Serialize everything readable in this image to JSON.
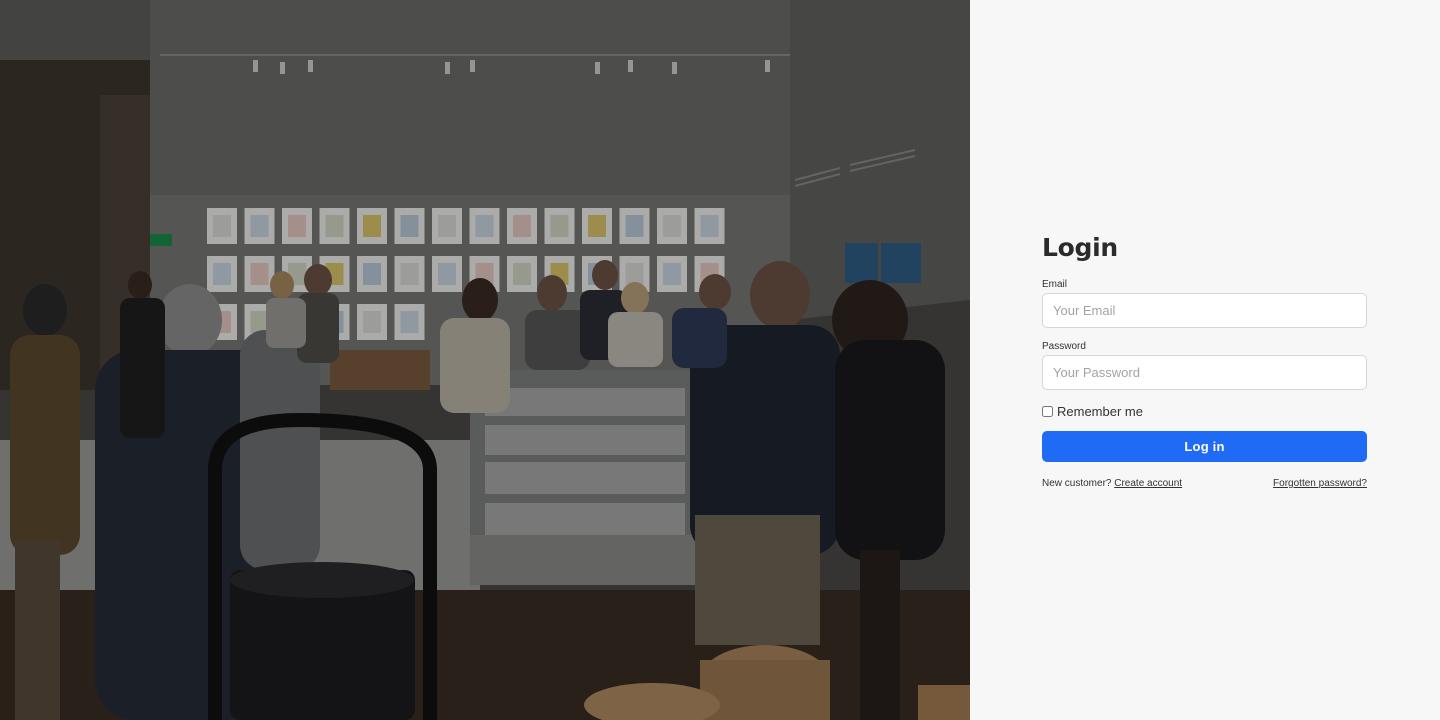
{
  "hero": {
    "image_alt": "Gallery exhibition with visitors"
  },
  "login": {
    "title": "Login",
    "email_label": "Email",
    "email_placeholder": "Your Email",
    "email_value": "",
    "password_label": "Password",
    "password_placeholder": "Your Password",
    "password_value": "",
    "remember_label": "Remember me",
    "remember_checked": false,
    "submit_label": "Log in",
    "new_customer_text": "New customer?",
    "create_account_link": "Create account",
    "forgot_password_link": "Forgotten password?"
  },
  "colors": {
    "primary": "#1f6bf6",
    "panel_background": "#f7f7f7",
    "text": "#2b2b2b"
  }
}
